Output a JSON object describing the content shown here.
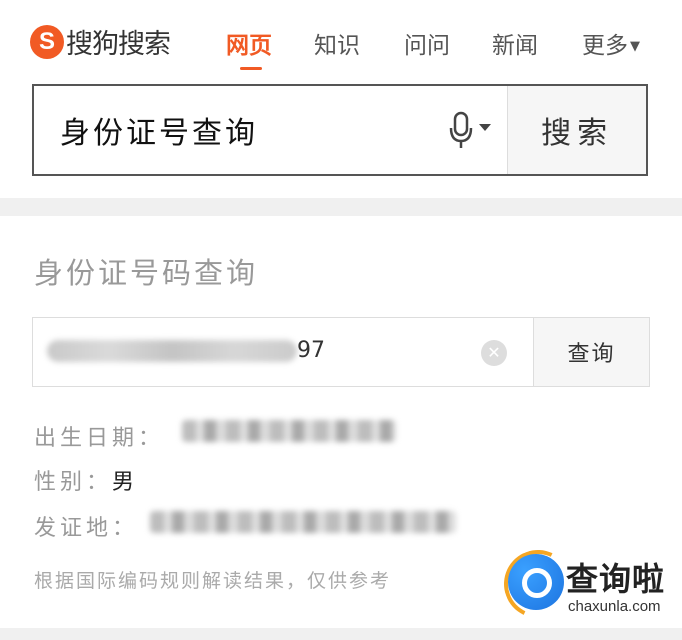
{
  "header": {
    "logo_letter": "S",
    "logo_text": "搜狗搜索",
    "nav": [
      "网页",
      "知识",
      "问问",
      "新闻",
      "更多"
    ],
    "accent_color": "#f15a24"
  },
  "search": {
    "query": "身份证号查询",
    "button_label": "搜索"
  },
  "card": {
    "title": "身份证号码查询",
    "id_suffix": "97",
    "query_button": "查询",
    "rows": [
      {
        "label": "出生日期：",
        "value": ""
      },
      {
        "label": "性别：",
        "value": "男"
      },
      {
        "label": "发证地：",
        "value": ""
      }
    ],
    "note": "根据国际编码规则解读结果，仅供参考"
  },
  "watermark": {
    "title": "查询啦",
    "subtitle": "chaxunla.com"
  }
}
